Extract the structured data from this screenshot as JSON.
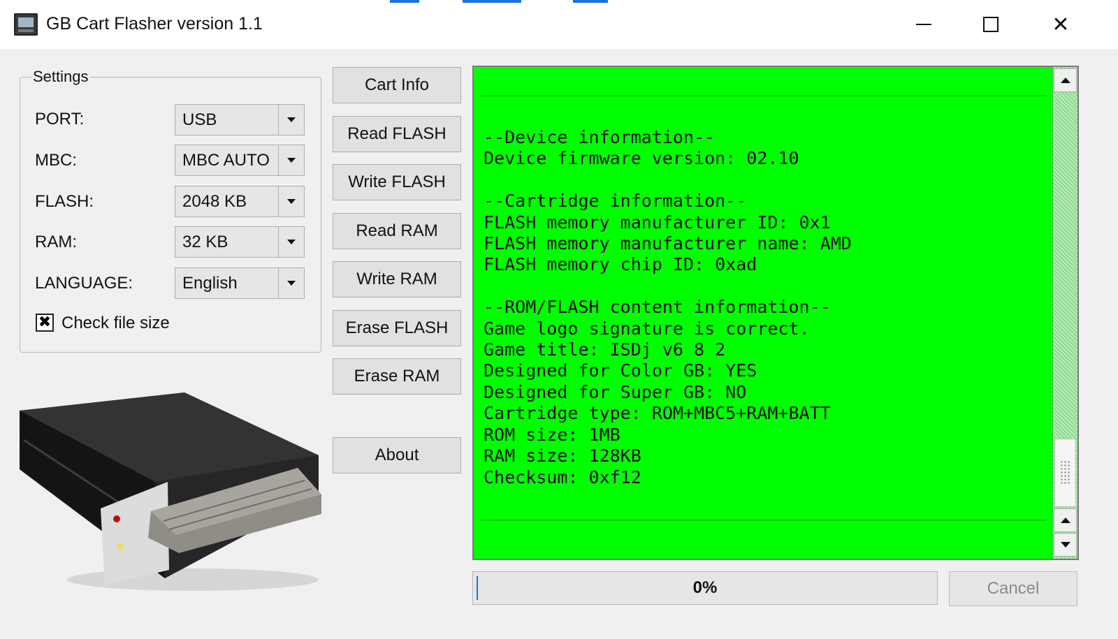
{
  "window": {
    "title": "GB Cart Flasher version 1.1",
    "icon": "gameboy-cart-flasher-icon",
    "accent_color": "#1e73d8",
    "controls": {
      "minimize": "minimize-icon",
      "maximize": "maximize-icon",
      "close": "close-icon"
    }
  },
  "settings": {
    "legend": "Settings",
    "port": {
      "label": "PORT:",
      "value": "USB"
    },
    "mbc": {
      "label": "MBC:",
      "value": "MBC AUTO"
    },
    "flash": {
      "label": "FLASH:",
      "value": "2048 KB"
    },
    "ram": {
      "label": "RAM:",
      "value": "32 KB"
    },
    "language": {
      "label": "LANGUAGE:",
      "value": "English"
    },
    "check_file_size": {
      "label": "Check file size",
      "checked": true,
      "mark": "✖"
    }
  },
  "actions": {
    "cart_info": "Cart Info",
    "read_flash": "Read FLASH",
    "write_flash": "Write FLASH",
    "read_ram": "Read RAM",
    "write_ram": "Write RAM",
    "erase_flash": "Erase FLASH",
    "erase_ram": "Erase RAM",
    "about": "About"
  },
  "console": {
    "background": "#00ff00",
    "lines": [
      "--Device information--",
      "Device firmware version: 02.10",
      "",
      "--Cartridge information--",
      "FLASH memory manufacturer ID: 0x1",
      "FLASH memory manufacturer name: AMD",
      "FLASH memory chip ID: 0xad",
      "",
      "--ROM/FLASH content information--",
      "Game logo signature is correct.",
      "Game title: ISDj v6 8 2",
      "Designed for Color GB: YES",
      "Designed for Super GB: NO",
      "Cartridge type: ROM+MBC5+RAM+BATT",
      "ROM size: 1MB",
      "RAM size: 128KB",
      "Checksum: 0xf12"
    ]
  },
  "progress": {
    "label": "0%",
    "value": 0
  },
  "cancel": {
    "label": "Cancel",
    "enabled": false
  }
}
